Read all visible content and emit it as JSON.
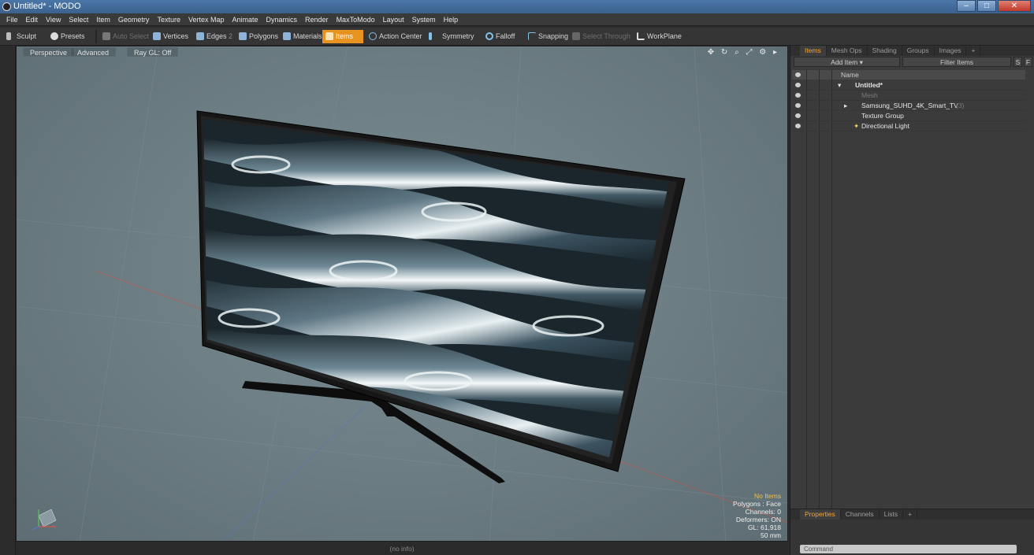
{
  "window": {
    "title": "Untitled* - MODO",
    "minimize": "‒",
    "maximize": "□",
    "close": "✕"
  },
  "menu": [
    "File",
    "Edit",
    "View",
    "Select",
    "Item",
    "Geometry",
    "Texture",
    "Vertex Map",
    "Animate",
    "Dynamics",
    "Render",
    "MaxToModo",
    "Layout",
    "System",
    "Help"
  ],
  "toolbar": {
    "sculpt": "Sculpt",
    "presets": "Presets",
    "auto_select": "Auto Select",
    "vertices": "Vertices",
    "edges": "Edges",
    "edges_count": "2",
    "polygons": "Polygons",
    "materials": "Materials",
    "items": "Items",
    "action_center": "Action Center",
    "symmetry": "Symmetry",
    "falloff": "Falloff",
    "snapping": "Snapping",
    "select_through": "Select Through",
    "workplane": "WorkPlane"
  },
  "viewport": {
    "tabs": [
      "Perspective",
      "Advanced",
      "Ray GL: Off"
    ],
    "icons": "✥ ↻ ⌕ ⤢ ⚙ ▸",
    "stats": {
      "items": "No Items",
      "polygons": "Polygons : Face",
      "channels": "Channels: 0",
      "deformers": "Deformers: ON",
      "gl": "GL: 61,918",
      "scale": "50 mm"
    },
    "status": "(no info)"
  },
  "panel": {
    "tabs": [
      "Items",
      "Mesh Ops",
      "Shading",
      "Groups",
      "Images",
      "+"
    ],
    "add_item": "Add Item",
    "filter_placeholder": "Filter Items",
    "s_btn": "S",
    "f_btn": "F",
    "column_name": "Name",
    "tree": [
      {
        "label": "Untitled*",
        "count": "",
        "indent": 0,
        "bold": true,
        "dim": false
      },
      {
        "label": "Mesh",
        "count": "",
        "indent": 1,
        "bold": false,
        "dim": true
      },
      {
        "label": "Samsung_SUHD_4K_Smart_TV",
        "count": "(3)",
        "indent": 1,
        "bold": false,
        "dim": false
      },
      {
        "label": "Texture Group",
        "count": "",
        "indent": 1,
        "bold": false,
        "dim": false
      },
      {
        "label": "Directional Light",
        "count": "",
        "indent": 1,
        "bold": false,
        "dim": false
      }
    ],
    "bottom_tabs": [
      "Properties",
      "Channels",
      "Lists",
      "+"
    ],
    "command_placeholder": "Command"
  }
}
